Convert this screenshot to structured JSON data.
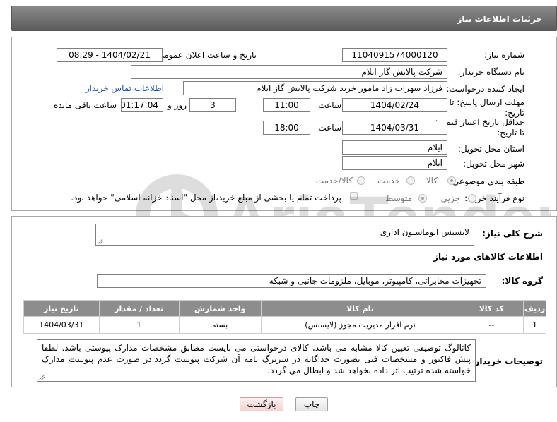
{
  "header": {
    "title": "جزئیات اطلاعات نیاز"
  },
  "need_number": {
    "label": "شماره نیاز:",
    "value": "1104091574000120"
  },
  "announce_datetime": {
    "label": "تاریخ و ساعت اعلان عمومی:",
    "value": "1404/02/21 - 08:29"
  },
  "buyer_org": {
    "label": "نام دستگاه خریدار:",
    "value": "شرکت پالایش گاز ایلام"
  },
  "requester": {
    "label": "ایجاد کننده درخواست:",
    "value": "فرزاد سهراب زاد مامور خرید شرکت پالایش گاز ایلام",
    "contact_link": "اطلاعات تماس خریدار"
  },
  "reply_deadline": {
    "label_line1": "مهلت ارسال پاسخ: تا",
    "label_line2": "تاریخ:",
    "date": "1404/02/24",
    "time_label": "ساعت",
    "time": "11:00",
    "days": "3",
    "days_label": "روز و",
    "remaining": "01:17:04",
    "remaining_label": "ساعت باقی مانده"
  },
  "price_validity": {
    "label_line1": "حداقل تاریخ اعتبار قیمت:",
    "label_line2": "تا تاریخ:",
    "date": "1404/03/31",
    "time_label": "ساعت",
    "time": "18:00"
  },
  "delivery_province": {
    "label": "استان محل تحویل:",
    "value": "ایلام"
  },
  "delivery_city": {
    "label": "شهر محل تحویل:",
    "value": "ایلام"
  },
  "category": {
    "label": "طبقه بندی موضوعی:",
    "options": [
      "کالا",
      "خدمت",
      "کالا/خدمت"
    ],
    "selected": "کالا"
  },
  "purchase_process": {
    "label": "نوع فرآیند خرید :",
    "options": [
      "جزیی",
      "متوسط"
    ],
    "selected": "متوسط",
    "payment_note": "پرداخت تمام یا بخشی از مبلغ خرید،از محل \"اسناد خزانه اسلامی\" خواهد بود."
  },
  "general_description": {
    "label": "شرح کلی نیاز:",
    "value": "لایسنس اتوماسیون اداری"
  },
  "goods_info_title": "اطلاعات کالاهای مورد نیاز",
  "goods_group": {
    "label": "گروه کالا:",
    "value": "تجهیزات مخابراتی، کامپیوتر، موبایل، ملزومات جانبی و شبکه"
  },
  "items_table": {
    "headers": [
      "ردیف",
      "کد کالا",
      "نام کالا",
      "واحد شمارش",
      "تعداد / مقدار",
      "تاریخ نیاز"
    ],
    "rows": [
      [
        "1",
        "--",
        "نرم افزار مدیریت مجوز (لایسنس)",
        "بسته",
        "1",
        "1404/03/31"
      ]
    ]
  },
  "buyer_notes": {
    "label": "توضیحات خریدار:",
    "value": "کاتالوگ توصیفی تعیین کالا مشابه می باشد، کالای درخواستی می بایست مطابق مشخصات مدارک پیوستی باشد. لطفا پیش فاکتور و مشخصات فنی بصورت جداگانه در سربرگ نامه آن شرکت پیوست گردد.در صورت عدم پیوست مدارک خواسته شده ترتیب اثر داده نخواهد شد و ابطال می گردد."
  },
  "buttons": {
    "print": "چاپ",
    "back": "بازگشت"
  },
  "watermark_text": "AriaTender.neT"
}
